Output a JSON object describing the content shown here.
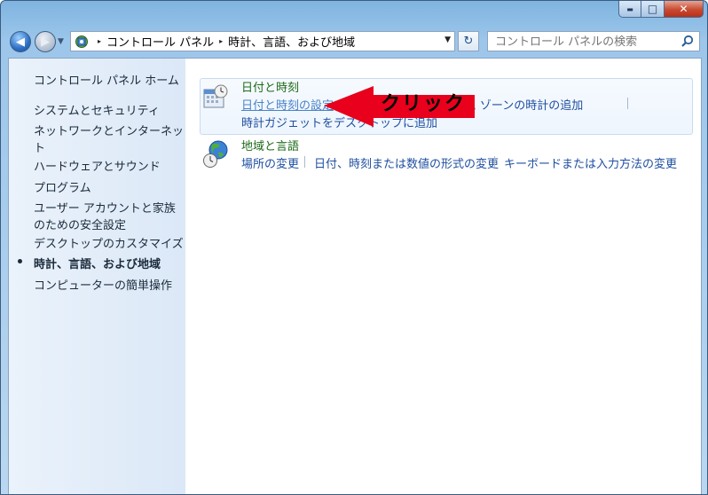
{
  "window": {
    "minimize": "▬",
    "maximize": "□",
    "close": "✕"
  },
  "nav": {
    "back": "◀",
    "forward": "▶",
    "dropdown": "▼",
    "refresh": "↻"
  },
  "address": {
    "crumbs": [
      "コントロール パネル",
      "時計、言語、および地域"
    ],
    "separator": "▸",
    "arrow": "▼"
  },
  "search": {
    "placeholder": "コントロール パネルの検索"
  },
  "sidebar": {
    "home": "コントロール パネル ホーム",
    "items": [
      "システムとセキュリティ",
      "ネットワークとインターネット",
      "ハードウェアとサウンド",
      "プログラム",
      "ユーザー アカウントと家族のための安全設定",
      "デスクトップのカスタマイズ",
      "時計、言語、および地域",
      "コンピューターの簡単操作"
    ]
  },
  "categories": {
    "datetime": {
      "title": "日付と時刻",
      "links": [
        "日付と時刻の設定",
        "別のタイム ゾーンの時計の追加",
        "時計ガジェットをデスクトップに追加"
      ]
    },
    "region": {
      "title": "地域と言語",
      "links": [
        "場所の変更",
        "日付、時刻または数値の形式の変更",
        "キーボードまたは入力方法の変更"
      ]
    }
  },
  "annotation": {
    "callout": "クリック",
    "color": "#e8001c"
  },
  "icons": [
    "control-panel-icon",
    "search-icon",
    "calendar-clock-icon",
    "globe-clock-icon",
    "refresh-icon"
  ]
}
